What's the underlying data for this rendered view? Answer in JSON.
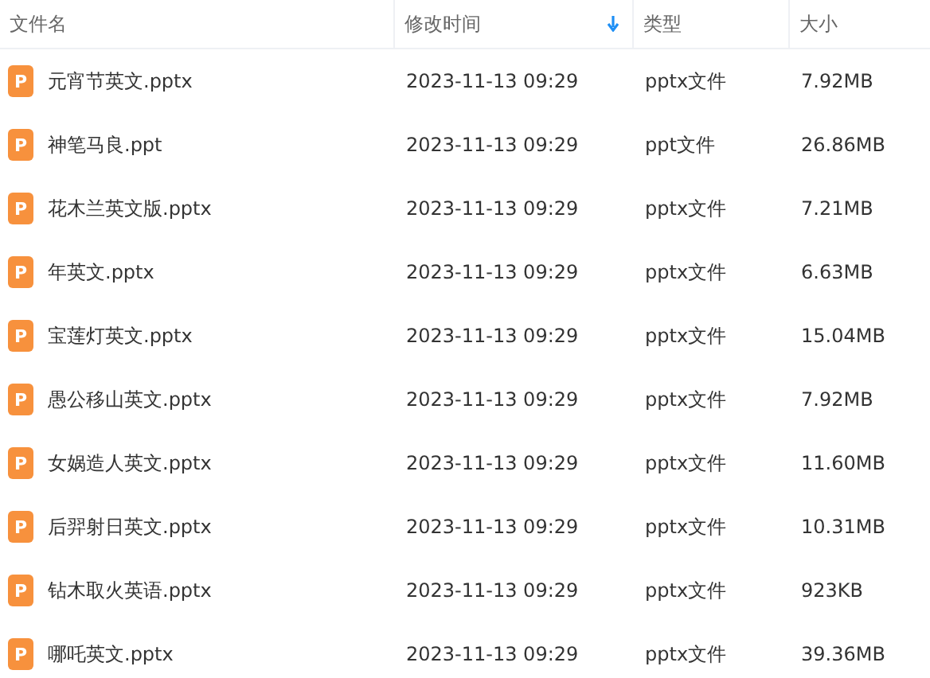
{
  "columns": [
    {
      "label": "文件名",
      "sorted": false
    },
    {
      "label": "修改时间",
      "sorted": true
    },
    {
      "label": "类型",
      "sorted": false
    },
    {
      "label": "大小",
      "sorted": false
    }
  ],
  "rows": [
    {
      "icon_label": "P",
      "name": "元宵节英文.pptx",
      "modified": "2023-11-13 09:29",
      "type": "pptx文件",
      "size": "7.92MB"
    },
    {
      "icon_label": "P",
      "name": "神笔马良.ppt",
      "modified": "2023-11-13 09:29",
      "type": "ppt文件",
      "size": "26.86MB"
    },
    {
      "icon_label": "P",
      "name": "花木兰英文版.pptx",
      "modified": "2023-11-13 09:29",
      "type": "pptx文件",
      "size": "7.21MB"
    },
    {
      "icon_label": "P",
      "name": "年英文.pptx",
      "modified": "2023-11-13 09:29",
      "type": "pptx文件",
      "size": "6.63MB"
    },
    {
      "icon_label": "P",
      "name": "宝莲灯英文.pptx",
      "modified": "2023-11-13 09:29",
      "type": "pptx文件",
      "size": "15.04MB"
    },
    {
      "icon_label": "P",
      "name": "愚公移山英文.pptx",
      "modified": "2023-11-13 09:29",
      "type": "pptx文件",
      "size": "7.92MB"
    },
    {
      "icon_label": "P",
      "name": "女娲造人英文.pptx",
      "modified": "2023-11-13 09:29",
      "type": "pptx文件",
      "size": "11.60MB"
    },
    {
      "icon_label": "P",
      "name": "后羿射日英文.pptx",
      "modified": "2023-11-13 09:29",
      "type": "pptx文件",
      "size": "10.31MB"
    },
    {
      "icon_label": "P",
      "name": "钻木取火英语.pptx",
      "modified": "2023-11-13 09:29",
      "type": "pptx文件",
      "size": "923KB"
    },
    {
      "icon_label": "P",
      "name": "哪吒英文.pptx",
      "modified": "2023-11-13 09:29",
      "type": "pptx文件",
      "size": "39.36MB"
    }
  ]
}
